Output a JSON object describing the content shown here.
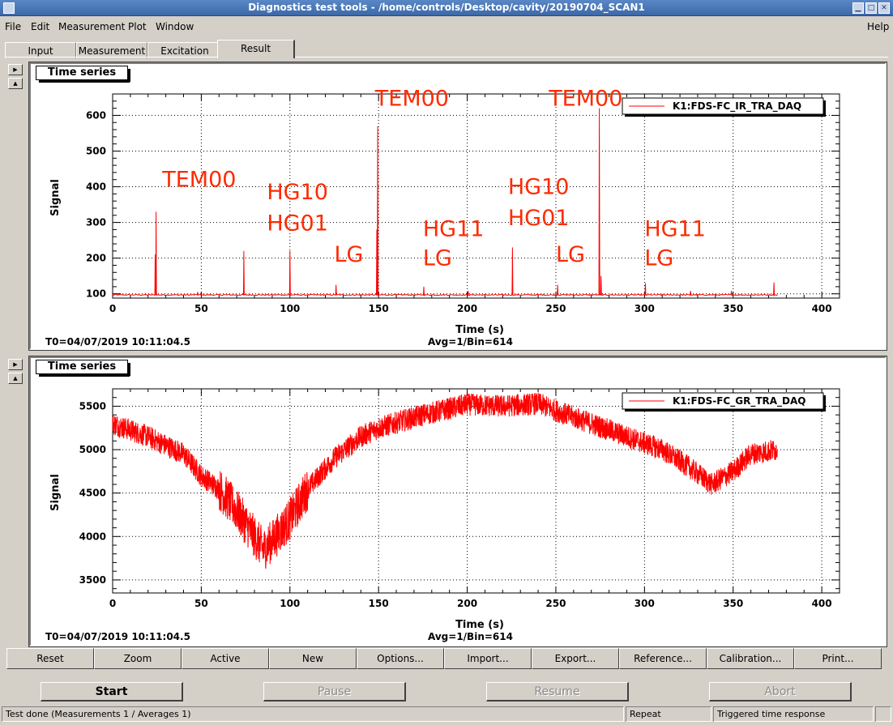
{
  "window": {
    "title": "Diagnostics test tools - /home/controls/Desktop/cavity/20190704_SCAN1"
  },
  "menu": {
    "file": "File",
    "edit": "Edit",
    "measurement": "Measurement",
    "plot": "Plot",
    "window": "Window",
    "help": "Help"
  },
  "tabs": [
    "Input",
    "Measurement",
    "Excitation",
    "Result"
  ],
  "active_tab": "Result",
  "panels": [
    {
      "title": "Time series",
      "t0": "T0=04/07/2019 10:11:04.5",
      "avg": "Avg=1/Bin=614"
    },
    {
      "title": "Time series",
      "t0": "T0=04/07/2019 10:11:04.5",
      "avg": "Avg=1/Bin=614"
    }
  ],
  "chart_data": [
    {
      "type": "line",
      "xlabel": "Time (s)",
      "ylabel": "Signal",
      "xlim": [
        0,
        410
      ],
      "ylim": [
        88,
        660
      ],
      "xticks": [
        0,
        50,
        100,
        150,
        200,
        250,
        300,
        350,
        400
      ],
      "yticks": [
        100,
        200,
        300,
        400,
        500,
        600
      ],
      "legend": {
        "position": "top-right"
      },
      "series": [
        {
          "name": "K1:FDS-FC_IR_TRA_DAQ",
          "color": "#ff0000",
          "baseline": 97,
          "peaks": [
            {
              "x": 24.5,
              "y": 330
            },
            {
              "x": 24.0,
              "y": 210
            },
            {
              "x": 48.0,
              "y": 105
            },
            {
              "x": 74.0,
              "y": 220
            },
            {
              "x": 100.0,
              "y": 220
            },
            {
              "x": 126.0,
              "y": 125
            },
            {
              "x": 149.5,
              "y": 570
            },
            {
              "x": 149.0,
              "y": 280
            },
            {
              "x": 175.5,
              "y": 120
            },
            {
              "x": 200.5,
              "y": 108
            },
            {
              "x": 225.5,
              "y": 230
            },
            {
              "x": 251.0,
              "y": 125
            },
            {
              "x": 274.5,
              "y": 620
            },
            {
              "x": 275.5,
              "y": 150
            },
            {
              "x": 300.5,
              "y": 130
            },
            {
              "x": 326.0,
              "y": 108
            },
            {
              "x": 349.0,
              "y": 108
            },
            {
              "x": 373.0,
              "y": 132
            }
          ]
        }
      ],
      "annotations": [
        {
          "text": "TEM00",
          "x": 28,
          "y": 400
        },
        {
          "text": "HG10",
          "x": 87,
          "y": 365
        },
        {
          "text": "HG01",
          "x": 87,
          "y": 278
        },
        {
          "text": "LG",
          "x": 125,
          "y": 190
        },
        {
          "text": "TEM00",
          "x": 148,
          "y": 627
        },
        {
          "text": "HG11",
          "x": 175,
          "y": 262
        },
        {
          "text": "LG",
          "x": 175,
          "y": 180
        },
        {
          "text": "HG10",
          "x": 223,
          "y": 380
        },
        {
          "text": "HG01",
          "x": 223,
          "y": 292
        },
        {
          "text": "LG",
          "x": 250,
          "y": 190
        },
        {
          "text": "TEM00",
          "x": 246,
          "y": 627
        },
        {
          "text": "HG11",
          "x": 300,
          "y": 262
        },
        {
          "text": "LG",
          "x": 300,
          "y": 180
        }
      ]
    },
    {
      "type": "line",
      "xlabel": "Time (s)",
      "ylabel": "Signal",
      "xlim": [
        0,
        410
      ],
      "ylim": [
        3350,
        5700
      ],
      "xticks": [
        0,
        50,
        100,
        150,
        200,
        250,
        300,
        350,
        400
      ],
      "yticks": [
        3500,
        4000,
        4500,
        5000,
        5500
      ],
      "legend": {
        "position": "top-right"
      },
      "series": [
        {
          "name": "K1:FDS-FC_GR_TRA_DAQ",
          "color": "#ff0000",
          "x": [
            0,
            20,
            40,
            50,
            60,
            70,
            80,
            85,
            90,
            100,
            110,
            125,
            140,
            150,
            175,
            200,
            220,
            240,
            250,
            270,
            290,
            310,
            325,
            338,
            350,
            360,
            375
          ],
          "y": [
            5300,
            5150,
            4950,
            4700,
            4550,
            4300,
            4000,
            3850,
            3950,
            4200,
            4550,
            4900,
            5150,
            5250,
            5400,
            5520,
            5500,
            5530,
            5450,
            5300,
            5150,
            5000,
            4800,
            4600,
            4750,
            4950,
            5000
          ],
          "noise": 130
        }
      ]
    }
  ],
  "toolbar": [
    "Reset",
    "Zoom",
    "Active",
    "New",
    "Options...",
    "Import...",
    "Export...",
    "Reference...",
    "Calibration...",
    "Print..."
  ],
  "controls": {
    "start": "Start",
    "pause": "Pause",
    "resume": "Resume",
    "abort": "Abort"
  },
  "status": {
    "message": "Test done (Measurements 1 / Averages 1)",
    "mode": "Repeat",
    "type": "Triggered time response"
  }
}
